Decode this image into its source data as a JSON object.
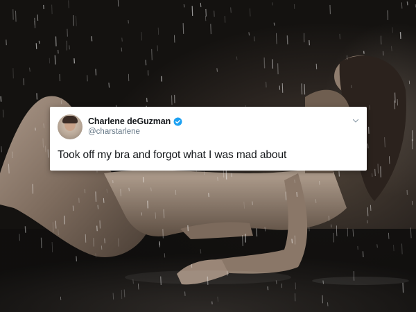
{
  "tweet": {
    "display_name": "Charlene deGuzman",
    "handle": "@charstarlene",
    "text": "Took off my bra and forgot what I was mad about",
    "verified": true
  },
  "colors": {
    "card_background": "#ffffff",
    "name_text": "#14171a",
    "handle_text": "#657786",
    "verified_badge": "#1da1f2"
  },
  "icons": {
    "verified": "verified-badge-icon",
    "menu": "chevron-down-icon",
    "avatar": "profile-avatar"
  }
}
